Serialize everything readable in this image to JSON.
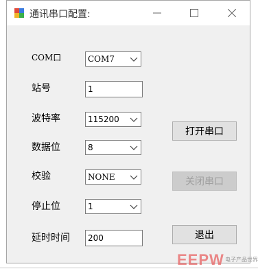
{
  "window": {
    "title": "通讯串口配置:"
  },
  "fields": {
    "com_label": "COM口",
    "com_value": "COM7",
    "station_label": "站号",
    "station_value": "1",
    "baud_label": "波特率",
    "baud_value": "115200",
    "databits_label": "数据位",
    "databits_value": "8",
    "parity_label": "校验",
    "parity_value": "NONE",
    "stopbits_label": "停止位",
    "stopbits_value": "1",
    "delay_label": "延时时间",
    "delay_value": "200"
  },
  "buttons": {
    "open_label": "打开串口",
    "close_label": "关闭串口",
    "close_enabled": false,
    "exit_label": "退出"
  },
  "watermark": {
    "logo": "EEPW",
    "text": "电子产品世界"
  },
  "colors": {
    "window_bg": "#f0f0f0",
    "button_bg": "#e1e1e1",
    "disabled_text": "#a0a0a0"
  }
}
